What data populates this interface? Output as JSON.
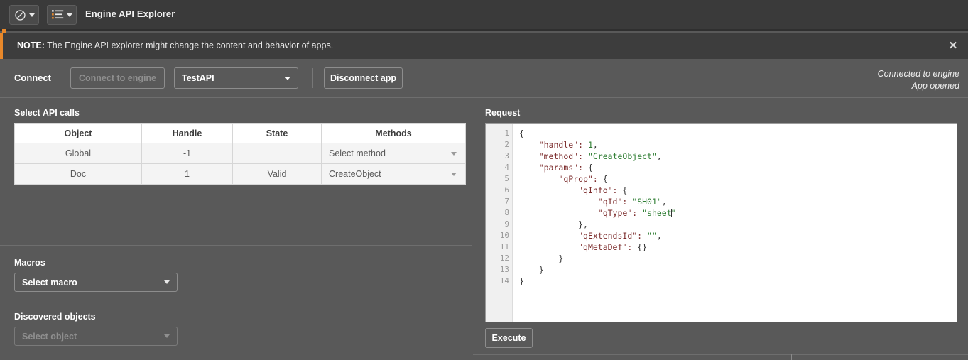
{
  "window": {
    "app_title": "Engine API Explorer",
    "accent_orange": "#e8882a",
    "accent_green": "#98c37f",
    "chrome_bg": "#3a3a3a",
    "body_bg": "#595959"
  },
  "toolbar": {
    "block_icon": "prohibited-circle-icon",
    "block_caret": "chevron-down-icon",
    "list_icon": "bullet-list-icon",
    "list_caret": "chevron-down-icon"
  },
  "note": {
    "prefix": "NOTE:",
    "message": " The Engine API explorer might change the content and behavior of apps.",
    "close_label": "✕"
  },
  "connect": {
    "label": "Connect",
    "connect_engine_button": "Connect to engine",
    "app_select_value": "TestAPI",
    "disconnect_button": "Disconnect app",
    "status_line_1": "Connected to engine",
    "status_line_2": "App opened"
  },
  "api_calls": {
    "title": "Select API calls",
    "columns": [
      "Object",
      "Handle",
      "State",
      "Methods"
    ],
    "rows": [
      {
        "object": "Global",
        "handle": "-1",
        "state": "",
        "method": "Select method"
      },
      {
        "object": "Doc",
        "handle": "1",
        "state": "Valid",
        "method": "CreateObject"
      }
    ]
  },
  "macros": {
    "title": "Macros",
    "select_value": "Select macro"
  },
  "discovered_objects": {
    "title": "Discovered objects",
    "select_value": "Select object"
  },
  "request": {
    "title": "Request",
    "execute_button": "Execute",
    "line_numbers": [
      "1",
      "2",
      "3",
      "4",
      "5",
      "6",
      "7",
      "8",
      "9",
      "10",
      "11",
      "12",
      "13",
      "14"
    ],
    "folds": [
      1,
      4,
      5,
      6
    ],
    "code_lines": [
      "{",
      "    \"handle\": 1,",
      "    \"method\": \"CreateObject\",",
      "    \"params\": {",
      "        \"qProp\": {",
      "            \"qInfo\": {",
      "                \"qId\": \"SH01\",",
      "                \"qType\": \"sheet\"",
      "            },",
      "            \"qExtendsId\": \"\",",
      "            \"qMetaDef\": {}",
      "        }",
      "    }",
      "}"
    ],
    "json_payload": {
      "handle": 1,
      "method": "CreateObject",
      "params": {
        "qProp": {
          "qInfo": {
            "qId": "SH01",
            "qType": "sheet"
          },
          "qExtendsId": "",
          "qMetaDef": {}
        }
      }
    },
    "syntax_colors": {
      "key": "#7b2b2b",
      "string": "#2e7d32",
      "number": "#2e7d32",
      "punctuation": "#333333",
      "gutter_text": "#9a9a9a"
    }
  }
}
